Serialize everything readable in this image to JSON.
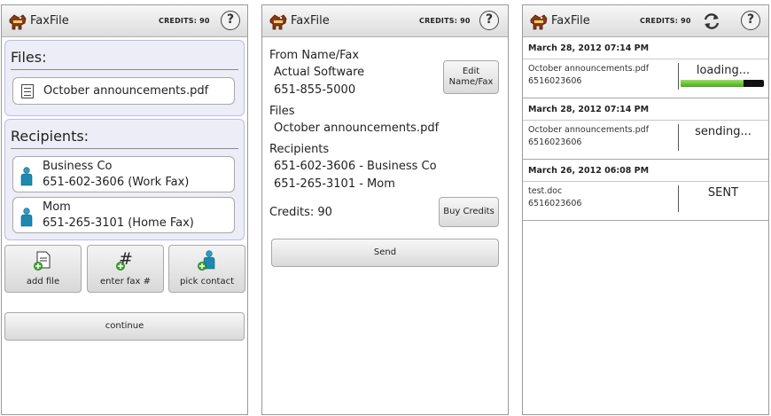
{
  "app": {
    "title": "FaxFile",
    "credits_label": "CREDITS: 90",
    "help_label": "?"
  },
  "screen1": {
    "files_title": "Files:",
    "file_name": "October announcements.pdf",
    "recipients_title": "Recipients:",
    "recipients": [
      {
        "name": "Business Co",
        "number": "651-602-3606 (Work Fax)"
      },
      {
        "name": "Mom",
        "number": "651-265-3101 (Home Fax)"
      }
    ],
    "buttons": {
      "add_file": "add file",
      "enter_fax": "enter fax #",
      "pick_contact": "pick contact"
    },
    "continue_label": "continue"
  },
  "screen2": {
    "from_label": "From Name/Fax",
    "from_name": "Actual Software",
    "from_fax": "651-855-5000",
    "edit_line1": "Edit",
    "edit_line2": "Name/Fax",
    "files_label": "Files",
    "file_name": "October announcements.pdf",
    "recipients_label": "Recipients",
    "recipients": [
      "651-602-3606 - Business Co",
      "651-265-3101 - Mom"
    ],
    "credits_text": "Credits: 90",
    "buy_credits": "Buy Credits",
    "send": "Send"
  },
  "screen3": {
    "jobs": [
      {
        "date": "March 28, 2012 07:14 PM",
        "file": "October announcements.pdf",
        "number": "6516023606",
        "status": "loading...",
        "progress": 0.75
      },
      {
        "date": "March 28, 2012 07:14 PM",
        "file": "October announcements.pdf",
        "number": "6516023606",
        "status": "sending..."
      },
      {
        "date": "March 26, 2012 06:08 PM",
        "file": "test.doc",
        "number": "6516023606",
        "status": "SENT"
      }
    ]
  },
  "colors": {
    "section_bg": "#ededf7",
    "progress_green": "#6cc832",
    "button_gradient_top": "#f7f7f7"
  }
}
